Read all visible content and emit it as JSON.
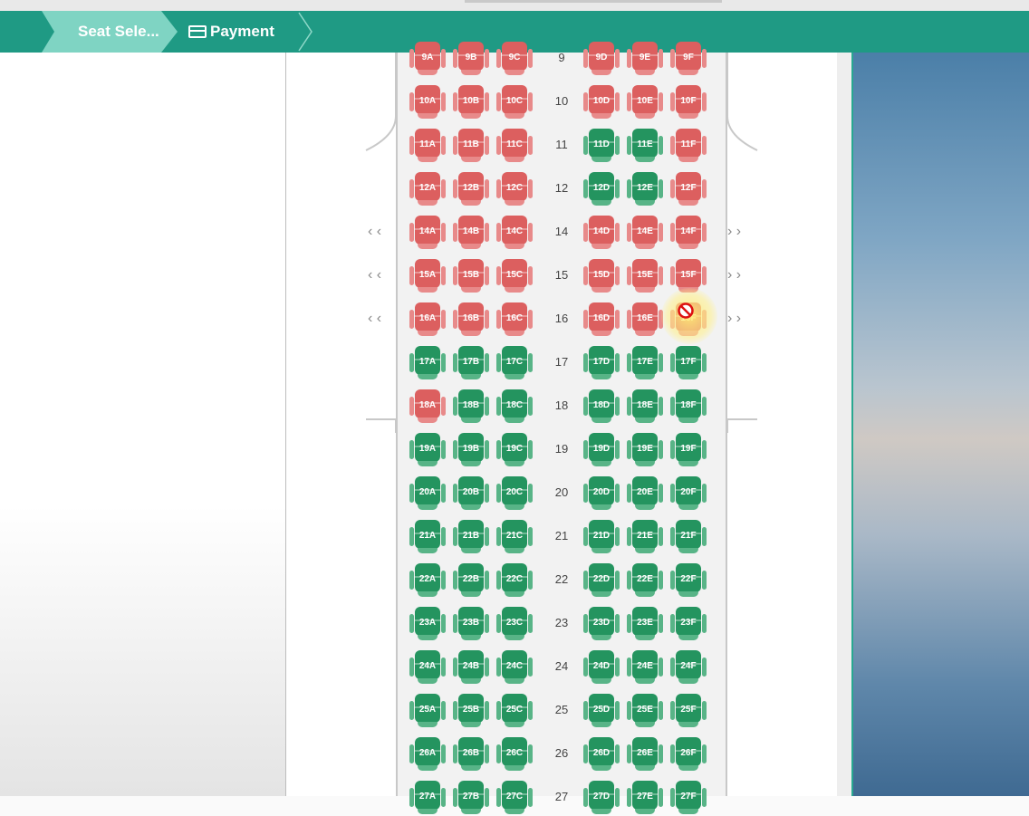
{
  "breadcrumb": {
    "seat_selection": "Seat Sele...",
    "payment": "Payment"
  },
  "colors": {
    "navbar": "#1f9a84",
    "active_step": "#7fd4c3",
    "occupied_seat": "#dc5f5f",
    "available_seat": "#24945f"
  },
  "seat_map": {
    "columns_left": [
      "A",
      "B",
      "C"
    ],
    "columns_right": [
      "D",
      "E",
      "F"
    ],
    "rows": [
      {
        "row": "9",
        "seats": {
          "A": "occupied",
          "B": "occupied",
          "C": "occupied",
          "D": "occupied",
          "E": "occupied",
          "F": "occupied"
        }
      },
      {
        "row": "10",
        "seats": {
          "A": "occupied",
          "B": "occupied",
          "C": "occupied",
          "D": "occupied",
          "E": "occupied",
          "F": "occupied"
        }
      },
      {
        "row": "11",
        "seats": {
          "A": "occupied",
          "B": "occupied",
          "C": "occupied",
          "D": "available",
          "E": "available",
          "F": "occupied"
        }
      },
      {
        "row": "12",
        "seats": {
          "A": "occupied",
          "B": "occupied",
          "C": "occupied",
          "D": "available",
          "E": "available",
          "F": "occupied"
        }
      },
      {
        "row": "14",
        "exit": true,
        "seats": {
          "A": "occupied",
          "B": "occupied",
          "C": "occupied",
          "D": "occupied",
          "E": "occupied",
          "F": "occupied"
        }
      },
      {
        "row": "15",
        "exit": true,
        "seats": {
          "A": "occupied",
          "B": "occupied",
          "C": "occupied",
          "D": "occupied",
          "E": "occupied",
          "F": "occupied"
        }
      },
      {
        "row": "16",
        "exit": true,
        "seats": {
          "A": "occupied",
          "B": "occupied",
          "C": "occupied",
          "D": "occupied",
          "E": "occupied",
          "F": "occupied"
        }
      },
      {
        "row": "17",
        "seats": {
          "A": "available",
          "B": "available",
          "C": "available",
          "D": "available",
          "E": "available",
          "F": "available"
        }
      },
      {
        "row": "18",
        "seats": {
          "A": "occupied",
          "B": "available",
          "C": "available",
          "D": "available",
          "E": "available",
          "F": "available"
        }
      },
      {
        "row": "19",
        "seats": {
          "A": "available",
          "B": "available",
          "C": "available",
          "D": "available",
          "E": "available",
          "F": "available"
        }
      },
      {
        "row": "20",
        "seats": {
          "A": "available",
          "B": "available",
          "C": "available",
          "D": "available",
          "E": "available",
          "F": "available"
        }
      },
      {
        "row": "21",
        "seats": {
          "A": "available",
          "B": "available",
          "C": "available",
          "D": "available",
          "E": "available",
          "F": "available"
        }
      },
      {
        "row": "22",
        "seats": {
          "A": "available",
          "B": "available",
          "C": "available",
          "D": "available",
          "E": "available",
          "F": "available"
        }
      },
      {
        "row": "23",
        "seats": {
          "A": "available",
          "B": "available",
          "C": "available",
          "D": "available",
          "E": "available",
          "F": "available"
        }
      },
      {
        "row": "24",
        "seats": {
          "A": "available",
          "B": "available",
          "C": "available",
          "D": "available",
          "E": "available",
          "F": "available"
        }
      },
      {
        "row": "25",
        "seats": {
          "A": "available",
          "B": "available",
          "C": "available",
          "D": "available",
          "E": "available",
          "F": "available"
        }
      },
      {
        "row": "26",
        "seats": {
          "A": "available",
          "B": "available",
          "C": "available",
          "D": "available",
          "E": "available",
          "F": "available"
        }
      },
      {
        "row": "27",
        "seats": {
          "A": "available",
          "B": "available",
          "C": "available",
          "D": "available",
          "E": "available",
          "F": "available"
        }
      }
    ],
    "hovered_seat": "16F",
    "hovered_state": "not-allowed"
  },
  "exit_markers": {
    "left": "‹ ‹",
    "right": "› ›"
  }
}
